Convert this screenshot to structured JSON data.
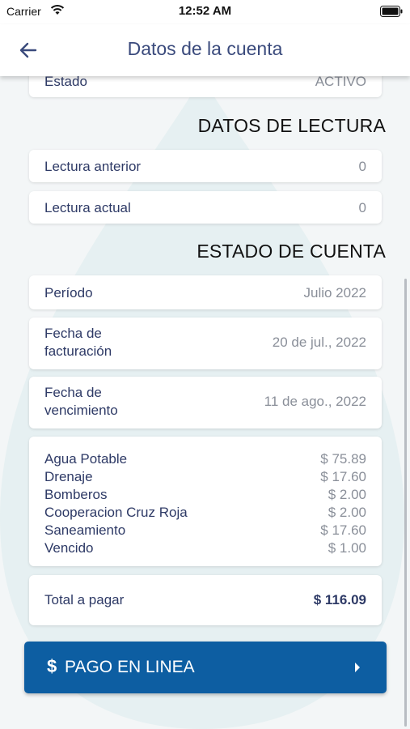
{
  "status_bar": {
    "carrier": "Carrier",
    "time": "12:52 AM"
  },
  "header": {
    "title": "Datos de la cuenta"
  },
  "cuenta": {
    "estado_label": "Estado",
    "estado_value": "ACTIVO"
  },
  "lectura": {
    "section_title": "DATOS DE LECTURA",
    "anterior_label": "Lectura anterior",
    "anterior_value": "0",
    "actual_label": "Lectura actual",
    "actual_value": "0"
  },
  "estado_cuenta": {
    "section_title": "ESTADO DE CUENTA",
    "periodo_label": "Período",
    "periodo_value": "Julio 2022",
    "facturacion_label_1": "Fecha de",
    "facturacion_label_2": "facturación",
    "facturacion_value": "20 de jul., 2022",
    "vencimiento_label_1": "Fecha de",
    "vencimiento_label_2": "vencimiento",
    "vencimiento_value": "11 de ago., 2022",
    "charges": [
      {
        "name": "Agua Potable",
        "amount": "$ 75.89"
      },
      {
        "name": "Drenaje",
        "amount": "$ 17.60"
      },
      {
        "name": "Bomberos",
        "amount": "$ 2.00"
      },
      {
        "name": "Cooperacion Cruz Roja",
        "amount": "$ 2.00"
      },
      {
        "name": "Saneamiento",
        "amount": "$ 17.60"
      },
      {
        "name": "Vencido",
        "amount": "$ 1.00"
      }
    ],
    "total_label": "Total a pagar",
    "total_value": "$ 116.09"
  },
  "pay_button": {
    "symbol": "$",
    "label": "PAGO EN LINEA"
  },
  "colors": {
    "primary": "#0d5ea2",
    "text_navy": "#2e3a66",
    "value_gray": "#8a8f99",
    "background": "#f3f6f7"
  },
  "icons": {
    "back": "arrow-left-icon",
    "wifi": "wifi-icon",
    "battery": "battery-icon",
    "chevron": "chevron-right-icon"
  }
}
